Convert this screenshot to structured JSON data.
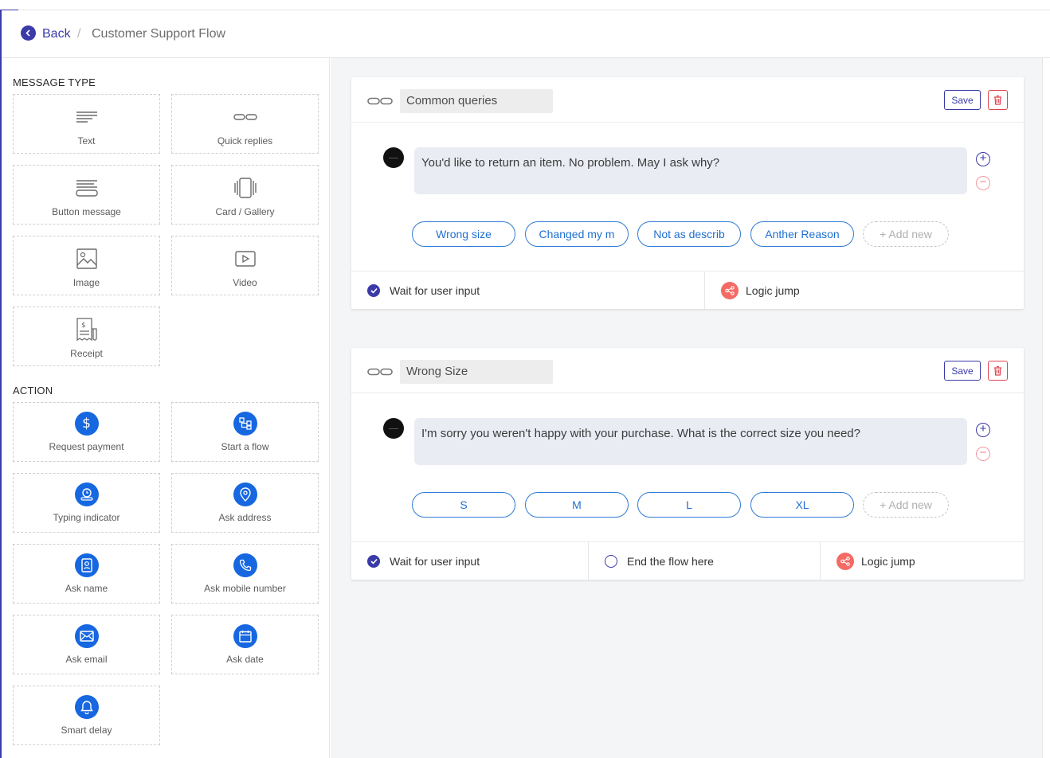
{
  "header": {
    "back_label": "Back",
    "separator": "/",
    "flow_title": "Customer Support Flow"
  },
  "sidebar": {
    "message_type_title": "MESSAGE TYPE",
    "message_types": [
      {
        "label": "Text",
        "icon": "text-lines-icon"
      },
      {
        "label": "Quick replies",
        "icon": "quick-replies-icon"
      },
      {
        "label": "Button message",
        "icon": "button-message-icon"
      },
      {
        "label": "Card / Gallery",
        "icon": "card-gallery-icon"
      },
      {
        "label": "Image",
        "icon": "image-icon"
      },
      {
        "label": "Video",
        "icon": "video-icon"
      },
      {
        "label": "Receipt",
        "icon": "receipt-icon"
      }
    ],
    "action_title": "ACTION",
    "actions": [
      {
        "label": "Request payment",
        "icon": "dollar-icon"
      },
      {
        "label": "Start a flow",
        "icon": "flow-icon"
      },
      {
        "label": "Typing indicator",
        "icon": "typing-indicator-icon"
      },
      {
        "label": "Ask address",
        "icon": "location-pin-icon"
      },
      {
        "label": "Ask name",
        "icon": "id-card-icon"
      },
      {
        "label": "Ask mobile number",
        "icon": "phone-icon"
      },
      {
        "label": "Ask email",
        "icon": "envelope-icon"
      },
      {
        "label": "Ask date",
        "icon": "calendar-icon"
      },
      {
        "label": "Smart delay",
        "icon": "bell-icon"
      }
    ]
  },
  "cards": [
    {
      "name": "Common queries",
      "save_label": "Save",
      "message": "You'd like to return an item. No problem. May I ask why?",
      "plus": "+",
      "minus": "−",
      "quick_replies": [
        "Wrong size",
        "Changed my m",
        "Not as describ",
        "Anther Reason"
      ],
      "add_new": "+ Add new",
      "wait_label": "Wait for user input",
      "logic_jump_label": "Logic jump"
    },
    {
      "name": "Wrong Size",
      "save_label": "Save",
      "message": "I'm sorry you weren't happy with your purchase. What is the correct size you need?",
      "plus": "+",
      "minus": "−",
      "quick_replies": [
        "S",
        "M",
        "L",
        "XL"
      ],
      "add_new": "+ Add new",
      "wait_label": "Wait for user input",
      "end_flow_label": "End the flow here",
      "logic_jump_label": "Logic jump"
    }
  ],
  "colors": {
    "primary": "#3a3aa8",
    "action_blue": "#1667e0",
    "danger": "#e2424f",
    "logic_jump": "#f46a64"
  }
}
